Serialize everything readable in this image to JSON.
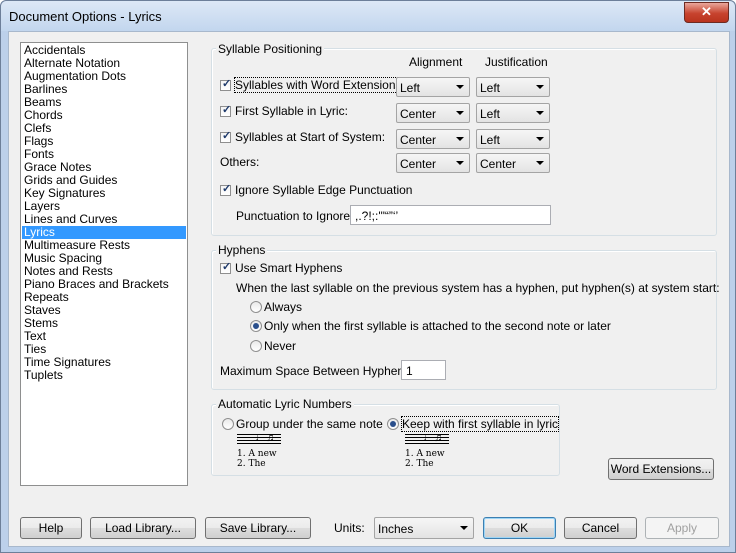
{
  "window": {
    "title": "Document Options - Lyrics",
    "close_glyph": "✕"
  },
  "sidebar": {
    "items": [
      "Accidentals",
      "Alternate Notation",
      "Augmentation Dots",
      "Barlines",
      "Beams",
      "Chords",
      "Clefs",
      "Flags",
      "Fonts",
      "Grace Notes",
      "Grids and Guides",
      "Key Signatures",
      "Layers",
      "Lines and Curves",
      "Lyrics",
      "Multimeasure Rests",
      "Music Spacing",
      "Notes and Rests",
      "Piano Braces and Brackets",
      "Repeats",
      "Staves",
      "Stems",
      "Text",
      "Ties",
      "Time Signatures",
      "Tuplets"
    ],
    "selected": "Lyrics"
  },
  "syllable": {
    "group_label": "Syllable Positioning",
    "col_alignment": "Alignment",
    "col_justification": "Justification",
    "rows": [
      {
        "label": "Syllables with Word Extensions:",
        "checked": true,
        "alignment": "Left",
        "justification": "Left"
      },
      {
        "label": "First Syllable in Lyric:",
        "checked": true,
        "alignment": "Center",
        "justification": "Left"
      },
      {
        "label": "Syllables at Start of System:",
        "checked": true,
        "alignment": "Center",
        "justification": "Left"
      }
    ],
    "others_label": "Others:",
    "others_alignment": "Center",
    "others_justification": "Center",
    "ignore_edge_label": "Ignore Syllable Edge Punctuation",
    "ignore_edge_checked": true,
    "punct_label": "Punctuation to Ignore:",
    "punct_value": ",.?!;:'\"“”‘’"
  },
  "hyphens": {
    "group_label": "Hyphens",
    "smart_label": "Use Smart Hyphens",
    "smart_checked": true,
    "desc": "When the last syllable on the previous system has a hyphen, put hyphen(s) at system start:",
    "options": [
      {
        "label": "Always",
        "selected": false
      },
      {
        "label": "Only when the first syllable is attached to the second note or later",
        "selected": true
      },
      {
        "label": "Never",
        "selected": false
      }
    ],
    "max_space_label": "Maximum Space Between Hyphens:",
    "max_space_value": "1"
  },
  "lyric_numbers": {
    "group_label": "Automatic Lyric Numbers",
    "opt_group": "Group under the same note",
    "opt_keep": "Keep with first syllable in lyric",
    "selected": "keep",
    "example_group_line1": "1. A    new",
    "example_group_line2": "2.        The",
    "example_keep_line1": "1. A    new",
    "example_keep_line2": "   2. The"
  },
  "buttons": {
    "word_extensions": "Word Extensions...",
    "help": "Help",
    "load_library": "Load Library...",
    "save_library": "Save Library...",
    "units_label": "Units:",
    "units_value": "Inches",
    "ok": "OK",
    "cancel": "Cancel",
    "apply": "Apply"
  }
}
